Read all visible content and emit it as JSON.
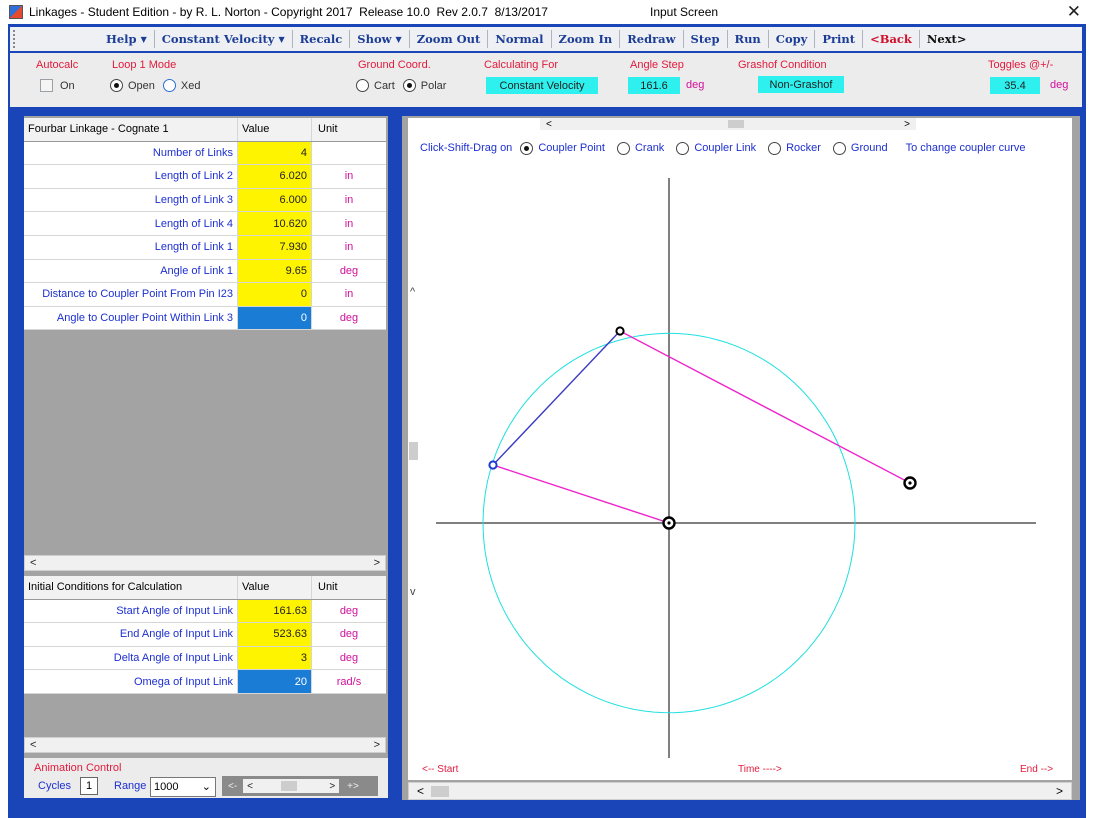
{
  "window": {
    "title": "Linkages - Student Edition - by R. L. Norton - Copyright 2017  Release 10.0  Rev 2.0.7  8/13/2017",
    "screen_name": "Input Screen",
    "close_glyph": "✕"
  },
  "menu": {
    "items": [
      {
        "label": "Help",
        "caret": "▼",
        "color": "blue"
      },
      {
        "label": "Constant Velocity",
        "caret": "▼",
        "color": "blue"
      },
      {
        "label": "Recalc",
        "color": "blue"
      },
      {
        "label": "Show",
        "caret": "▼",
        "color": "blue"
      },
      {
        "label": "Zoom Out",
        "color": "blue"
      },
      {
        "label": "Normal",
        "color": "blue"
      },
      {
        "label": "Zoom In",
        "color": "blue"
      },
      {
        "label": "Redraw",
        "color": "blue"
      },
      {
        "label": "Step",
        "color": "blue"
      },
      {
        "label": "Run",
        "color": "blue"
      },
      {
        "label": "Copy",
        "color": "blue"
      },
      {
        "label": "Print",
        "color": "blue"
      },
      {
        "label": "<Back",
        "color": "red"
      },
      {
        "label": "Next>",
        "color": "dark"
      }
    ]
  },
  "options": {
    "autocalc": {
      "label": "Autocalc",
      "option": "On"
    },
    "loop_mode": {
      "label": "Loop 1 Mode",
      "open": "Open",
      "xed": "Xed"
    },
    "ground_coord": {
      "label": "Ground Coord.",
      "cart": "Cart",
      "polar": "Polar"
    },
    "calculating_for": {
      "label": "Calculating For",
      "value": "Constant Velocity"
    },
    "angle_step": {
      "label": "Angle Step",
      "value": "161.6",
      "unit": "deg"
    },
    "grashof": {
      "label": "Grashof Condition",
      "value": "Non-Grashof"
    },
    "toggles": {
      "label": "Toggles @+/-",
      "value": "35.4",
      "unit": "deg"
    }
  },
  "linkage_table": {
    "headers": [
      "Fourbar Linkage - Cognate 1",
      "Value",
      "Unit"
    ],
    "rows": [
      {
        "name": "Number of Links",
        "value": "4",
        "unit": ""
      },
      {
        "name": "Length of Link 2",
        "value": "6.020",
        "unit": "in"
      },
      {
        "name": "Length of Link 3",
        "value": "6.000",
        "unit": "in"
      },
      {
        "name": "Length of Link 4",
        "value": "10.620",
        "unit": "in"
      },
      {
        "name": "Length of Link 1",
        "value": "7.930",
        "unit": "in"
      },
      {
        "name": "Angle of Link 1",
        "value": "9.65",
        "unit": "deg"
      },
      {
        "name": "Distance to Coupler Point From Pin I23",
        "value": "0",
        "unit": "in"
      },
      {
        "name": "Angle to Coupler Point Within Link 3",
        "value": "0",
        "unit": "deg",
        "selected": true
      }
    ]
  },
  "initial_table": {
    "headers": [
      "Initial Conditions for Calculation",
      "Value",
      "Unit"
    ],
    "rows": [
      {
        "name": "Start Angle of Input Link",
        "value": "161.63",
        "unit": "deg"
      },
      {
        "name": "End Angle of Input Link",
        "value": "523.63",
        "unit": "deg"
      },
      {
        "name": "Delta Angle of Input Link",
        "value": "3",
        "unit": "deg"
      },
      {
        "name": "Omega of Input Link",
        "value": "20",
        "unit": "rad/s",
        "selected": true
      }
    ]
  },
  "scroll_glyphs": {
    "left": "<",
    "right": ">",
    "up": "^",
    "down": "v"
  },
  "animation": {
    "label": "Animation Control",
    "cycles_label": "Cycles",
    "cycles_value": "1",
    "range_label": "Range",
    "range_value": "1000",
    "slow_label": "<-",
    "fast_label": "+>"
  },
  "canvas": {
    "click_instruction": "Click-Shift-Drag on",
    "options": [
      "Coupler Point",
      "Crank",
      "Coupler Link",
      "Rocker",
      "Ground"
    ],
    "selected_option": "Coupler Point",
    "instruction_tail": "To change coupler curve",
    "start_label": "<-- Start",
    "time_label": "Time ---->",
    "end_label": "End -->"
  },
  "colors": {
    "frame": "#1a45b8",
    "crank": "#3b3bc4",
    "coupler": "#ee22cc",
    "coupler_curve": "#1fe0e0",
    "accent_red": "#e11a3c",
    "unit_magenta": "#d0109a",
    "input_yellow": "#fff400",
    "selected_blue": "#1b7cd6"
  }
}
